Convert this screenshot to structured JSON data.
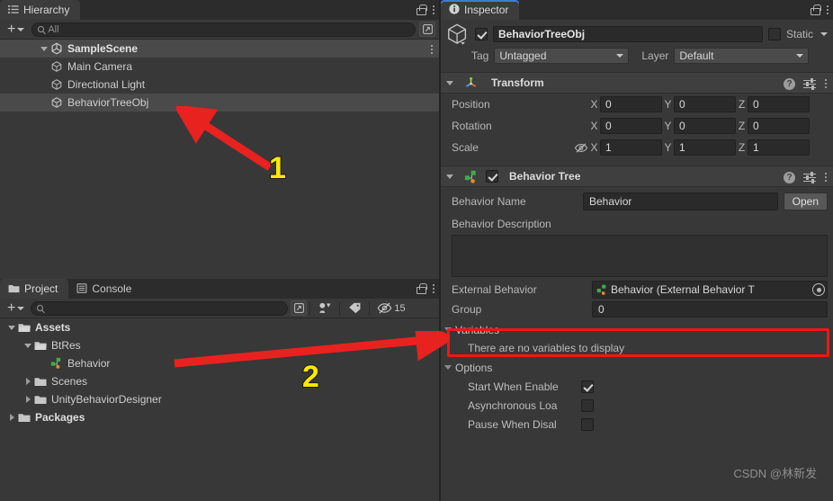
{
  "hierarchy": {
    "tab_label": "Hierarchy",
    "tab_icon": "hierarchy-icon",
    "add_label": "+",
    "search_placeholder": "All",
    "items": [
      {
        "label": "SampleScene",
        "icon": "unity-scene-icon",
        "depth": 0,
        "expanded": true,
        "selected": false,
        "bold": true
      },
      {
        "label": "Main Camera",
        "icon": "gameobject-cube-icon",
        "depth": 1,
        "expanded": null,
        "selected": false,
        "bold": false
      },
      {
        "label": "Directional Light",
        "icon": "gameobject-cube-icon",
        "depth": 1,
        "expanded": null,
        "selected": false,
        "bold": false
      },
      {
        "label": "BehaviorTreeObj",
        "icon": "gameobject-cube-icon",
        "depth": 1,
        "expanded": null,
        "selected": true,
        "bold": false
      }
    ]
  },
  "project": {
    "tabs": [
      {
        "label": "Project",
        "icon": "folder-icon",
        "active": true
      },
      {
        "label": "Console",
        "icon": "console-icon",
        "active": false
      }
    ],
    "add_label": "+",
    "search_placeholder": "",
    "visibility_count": "15",
    "items": [
      {
        "label": "Assets",
        "icon": "folder-open-icon",
        "depth": 0,
        "expanded": true,
        "bold": true
      },
      {
        "label": "BtRes",
        "icon": "folder-open-icon",
        "depth": 1,
        "expanded": true,
        "bold": false
      },
      {
        "label": "Behavior",
        "icon": "behavior-tree-asset-icon",
        "depth": 2,
        "expanded": null,
        "bold": false
      },
      {
        "label": "Scenes",
        "icon": "folder-icon",
        "depth": 1,
        "expanded": false,
        "bold": false
      },
      {
        "label": "UnityBehaviorDesigner",
        "icon": "folder-icon",
        "depth": 1,
        "expanded": false,
        "bold": false
      },
      {
        "label": "Packages",
        "icon": "folder-icon",
        "depth": 0,
        "expanded": false,
        "bold": true
      }
    ]
  },
  "inspector": {
    "tab_label": "Inspector",
    "tab_icon": "info-icon",
    "object_name": "BehaviorTreeObj",
    "object_enabled": true,
    "static_label": "Static",
    "static_checked": false,
    "tag_label": "Tag",
    "tag_value": "Untagged",
    "layer_label": "Layer",
    "layer_value": "Default",
    "transform": {
      "title": "Transform",
      "rows": [
        {
          "label": "Position",
          "x": "0",
          "y": "0",
          "z": "0"
        },
        {
          "label": "Rotation",
          "x": "0",
          "y": "0",
          "z": "0"
        },
        {
          "label": "Scale",
          "x": "1",
          "y": "1",
          "z": "1"
        }
      ],
      "axis_x": "X",
      "axis_y": "Y",
      "axis_z": "Z"
    },
    "behavior_tree": {
      "title": "Behavior Tree",
      "enabled": true,
      "behavior_name_label": "Behavior Name",
      "behavior_name_value": "Behavior",
      "open_button": "Open",
      "behavior_description_label": "Behavior Description",
      "behavior_description_value": "",
      "external_behavior_label": "External Behavior",
      "external_behavior_value": "Behavior (External Behavior T",
      "group_label": "Group",
      "group_value": "0",
      "variables_label": "Variables",
      "variables_empty": "There are no variables to display",
      "options_label": "Options",
      "options": [
        {
          "label": "Start When Enable",
          "checked": true
        },
        {
          "label": "Asynchronous Loa",
          "checked": false
        },
        {
          "label": "Pause When Disal",
          "checked": false
        }
      ]
    }
  },
  "annotations": {
    "marker_1": "1",
    "marker_2": "2",
    "highlight_color": "#f11616",
    "arrow_color": "#e8221f",
    "number_color": "#ffe800"
  },
  "watermark": {
    "text": "CSDN @林新发"
  }
}
